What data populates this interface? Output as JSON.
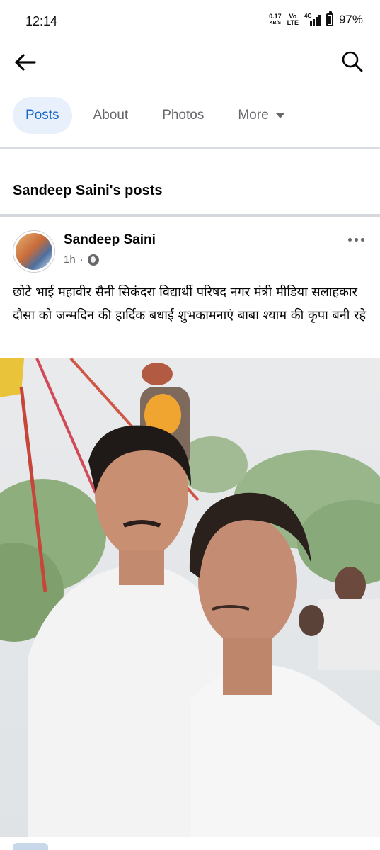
{
  "status_bar": {
    "time": "12:14",
    "net_speed_value": "0.17",
    "net_speed_unit": "KB/S",
    "volte_top": "Vo",
    "volte_bottom": "LTE",
    "network": "4G",
    "battery": "97%"
  },
  "header": {
    "back_icon": "arrow-left-icon",
    "search_icon": "search-icon"
  },
  "tabs": [
    {
      "label": "Posts",
      "active": true
    },
    {
      "label": "About",
      "active": false
    },
    {
      "label": "Photos",
      "active": false
    },
    {
      "label": "More",
      "active": false
    }
  ],
  "section_title": "Sandeep Saini's posts",
  "post": {
    "author": "Sandeep Saini",
    "time": "1h",
    "separator": "·",
    "privacy_icon": "globe-icon",
    "text": "छोटे भाई महावीर सैनी सिकंदरा विद्यार्थी परिषद नगर मंत्री मीडिया सलाहकार दौसा को जन्मदिन की हार्दिक बधाई शुभकामनाएं बाबा श्याम की कृपा बनी रहे"
  },
  "colors": {
    "accent": "#1a66c9",
    "active_tab_bg": "#e7f0fb",
    "secondary_text": "#65676b",
    "divider": "#dadde1"
  }
}
